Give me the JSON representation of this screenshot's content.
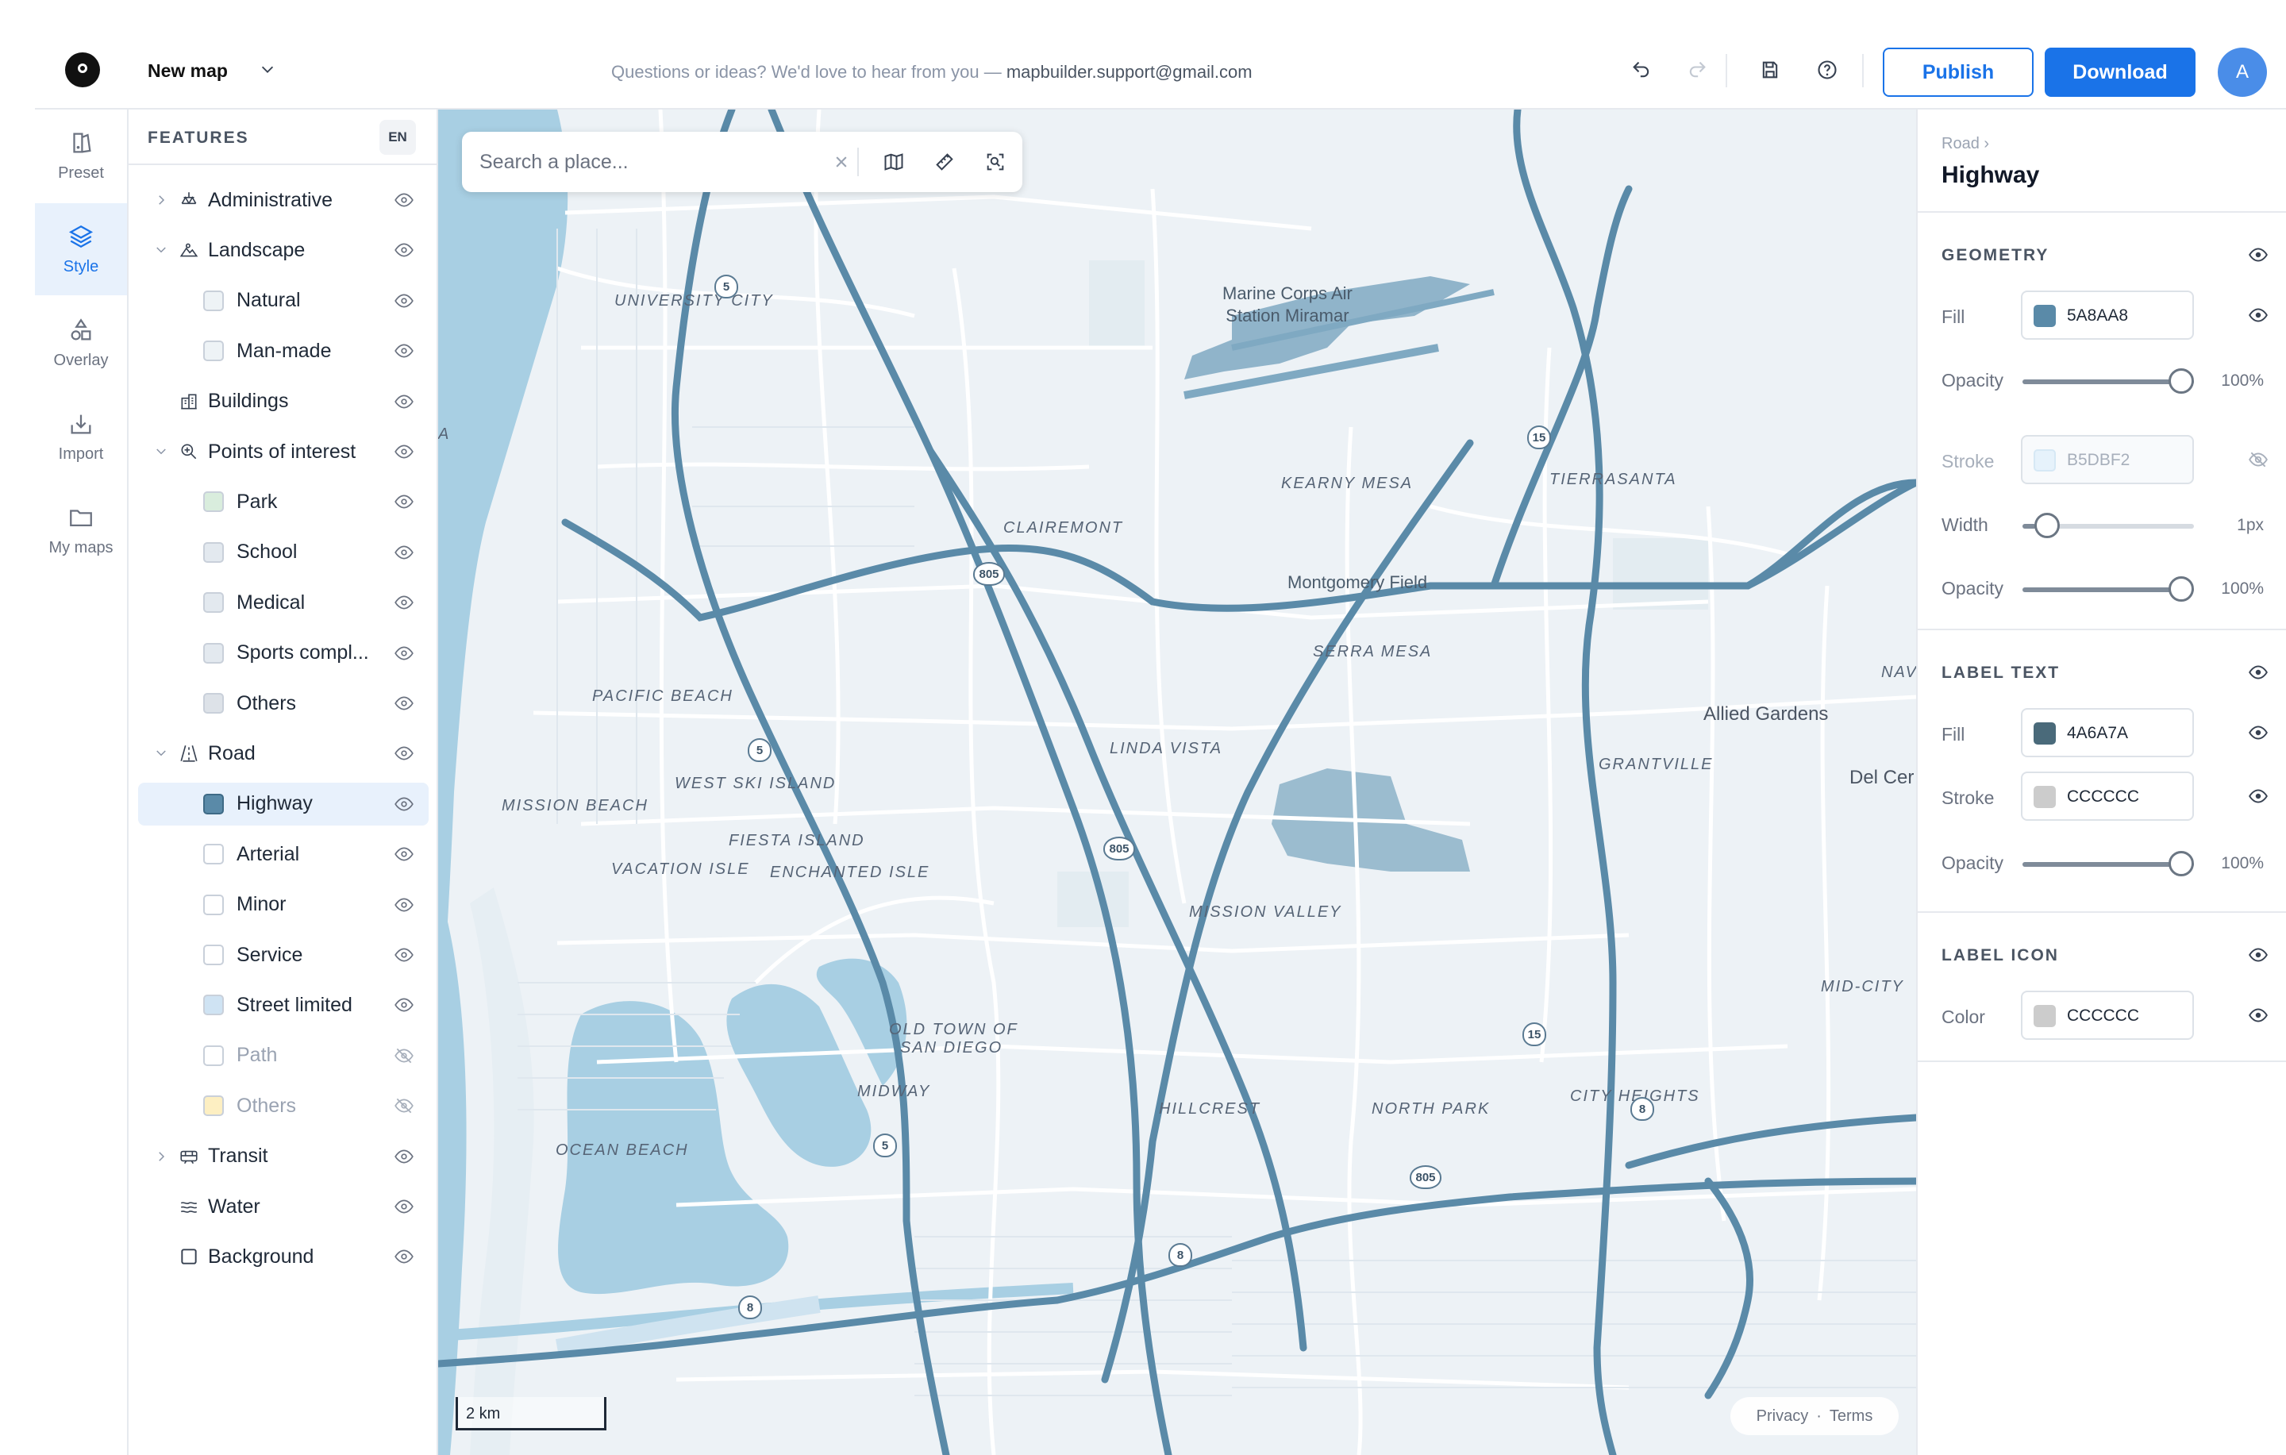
{
  "header": {
    "map_title": "New map",
    "support_text": "Questions or ideas? We'd love to hear from you — ",
    "support_email": "mapbuilder.support@gmail.com",
    "publish_label": "Publish",
    "download_label": "Download",
    "avatar_initial": "A"
  },
  "rail": [
    {
      "label": "Preset",
      "icon": "preset-icon"
    },
    {
      "label": "Style",
      "icon": "layers-icon",
      "active": true
    },
    {
      "label": "Overlay",
      "icon": "shapes-icon"
    },
    {
      "label": "Import",
      "icon": "import-icon"
    },
    {
      "label": "My maps",
      "icon": "folder-icon"
    }
  ],
  "features": {
    "title": "FEATURES",
    "lang": "EN",
    "items": [
      {
        "label": "Administrative",
        "level": 1,
        "expanded": false,
        "icon": "administrative-icon"
      },
      {
        "label": "Landscape",
        "level": 1,
        "expanded": true,
        "icon": "landscape-icon"
      },
      {
        "label": "Natural",
        "level": 2,
        "color": "#EEF3F6"
      },
      {
        "label": "Man-made",
        "level": 2,
        "color": "#EEF3F6"
      },
      {
        "label": "Buildings",
        "level": 1,
        "icon": "buildings-icon"
      },
      {
        "label": "Points of interest",
        "level": 1,
        "expanded": true,
        "icon": "poi-icon"
      },
      {
        "label": "Park",
        "level": 2,
        "color": "#D9EDDD"
      },
      {
        "label": "School",
        "level": 2,
        "color": "#E3E9EF"
      },
      {
        "label": "Medical",
        "level": 2,
        "color": "#E3E9EF"
      },
      {
        "label": "Sports compl...",
        "level": 2,
        "color": "#E3E9EF"
      },
      {
        "label": "Others",
        "level": 2,
        "color": "#DDE2E8"
      },
      {
        "label": "Road",
        "level": 1,
        "expanded": true,
        "icon": "road-icon"
      },
      {
        "label": "Highway",
        "level": 2,
        "color": "#5A8AA8",
        "selected": true
      },
      {
        "label": "Arterial",
        "level": 2,
        "color": "#FFFFFF"
      },
      {
        "label": "Minor",
        "level": 2,
        "color": "#FFFFFF"
      },
      {
        "label": "Service",
        "level": 2,
        "color": "#FFFFFF"
      },
      {
        "label": "Street limited",
        "level": 2,
        "color": "#CFE3F3"
      },
      {
        "label": "Path",
        "level": 2,
        "color": "#FFFFFF",
        "hidden": true
      },
      {
        "label": "Others",
        "level": 2,
        "color": "#FDEFC2",
        "hidden": true
      },
      {
        "label": "Transit",
        "level": 1,
        "expanded": false,
        "icon": "transit-icon"
      },
      {
        "label": "Water",
        "level": 1,
        "icon": "water-icon"
      },
      {
        "label": "Background",
        "level": 1,
        "icon": "background-icon"
      }
    ]
  },
  "map": {
    "search_placeholder": "Search a place...",
    "scale_label": "2 km",
    "privacy": "Privacy",
    "dot": "·",
    "terms": "Terms",
    "labels": {
      "university_city": "UNIVERSITY CITY",
      "miramar_1": "Marine Corps Air",
      "miramar_2": "Station Miramar",
      "kearny_mesa": "KEARNY MESA",
      "tierrasanta": "TIERRASANTA",
      "clairemont": "CLAIREMONT",
      "montgomery": "Montgomery Field",
      "serra_mesa": "SERRA MESA",
      "pacific_beach": "PACIFIC BEACH",
      "allied_gardens": "Allied Gardens",
      "linda_vista": "LINDA VISTA",
      "grantville": "GRANTVILLE",
      "west_ski": "WEST SKI ISLAND",
      "mission_beach": "MISSION BEACH",
      "fiesta_island": "FIESTA ISLAND",
      "vacation_isle": "VACATION ISLE",
      "enchanted_isle": "ENCHANTED ISLE",
      "mission_valley": "MISSION VALLEY",
      "del_cerro": "Del Cer",
      "nav": "NAV",
      "mid_city": "MID-CITY",
      "old_town_1": "OLD TOWN OF",
      "old_town_2": "SAN DIEGO",
      "midway": "MIDWAY",
      "hillcrest": "HILLCREST",
      "north_park": "NORTH PARK",
      "city_heights": "CITY HEIGHTS",
      "ocean_beach": "OCEAN BEACH",
      "edge_a": "A"
    },
    "shields": {
      "i5_a": "5",
      "i5_b": "5",
      "i5_c": "5",
      "i805_a": "805",
      "i805_b": "805",
      "i805_c": "805",
      "i15_a": "15",
      "i15_b": "15",
      "i8_a": "8",
      "i8_b": "8",
      "i8_c": "8"
    }
  },
  "style_panel": {
    "breadcrumb": "Road ›",
    "title": "Highway",
    "geometry": {
      "title": "GEOMETRY",
      "fill_label": "Fill",
      "fill_color": "#5A8AA8",
      "fill_hex": "5A8AA8",
      "opacity_label": "Opacity",
      "opacity_value": "100%",
      "opacity": 1.0,
      "stroke_label": "Stroke",
      "stroke_color": "#B5DBF2",
      "stroke_hex": "B5DBF2",
      "width_label": "Width",
      "width_value": "1px",
      "width_fraction": 0.08,
      "opacity2_label": "Opacity",
      "opacity2_value": "100%",
      "opacity2": 1.0
    },
    "label_text": {
      "title": "LABEL TEXT",
      "fill_label": "Fill",
      "fill_color": "#4A6A7A",
      "fill_hex": "4A6A7A",
      "stroke_label": "Stroke",
      "stroke_color": "#CCCCCC",
      "stroke_hex": "CCCCCC",
      "opacity_label": "Opacity",
      "opacity_value": "100%",
      "opacity": 1.0
    },
    "label_icon": {
      "title": "LABEL ICON",
      "color_label": "Color",
      "color": "#CCCCCC",
      "color_hex": "CCCCCC"
    }
  },
  "colors": {
    "accent": "#1A73E8",
    "water": "#A8CFE3",
    "highway": "#5A8AA8",
    "map_bg": "#EDF2F6",
    "airport": "#7FA9C2"
  }
}
